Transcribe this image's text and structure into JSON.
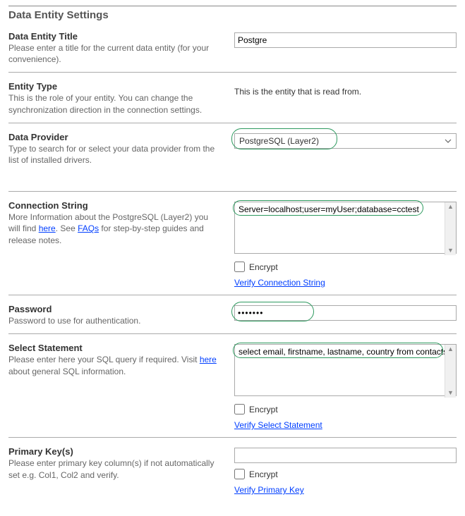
{
  "page_title": "Data Entity Settings",
  "title_section": {
    "label": "Data Entity Title",
    "desc": "Please enter a title for the current data entity (for your convenience).",
    "value": "Postgre"
  },
  "entity_type_section": {
    "label": "Entity Type",
    "desc": "This is the role of your entity. You can change the synchronization direction in the connection settings.",
    "static_text": "This is the entity that is read from."
  },
  "provider_section": {
    "label": "Data Provider",
    "desc": "Type to search for or select your data provider from the list of installed drivers.",
    "value": "PostgreSQL (Layer2)"
  },
  "conn_section": {
    "label": "Connection String",
    "desc_pre": "More Information about the PostgreSQL (Layer2) you will find ",
    "desc_link1": "here",
    "desc_mid": ". See ",
    "desc_link2": "FAQs",
    "desc_post": " for step-by-step guides and release notes.",
    "value": "Server=localhost;user=myUser;database=cctest",
    "encrypt_label": "Encrypt",
    "verify_label": "Verify Connection String"
  },
  "password_section": {
    "label": "Password",
    "desc": "Password to use for authentication.",
    "value": "•••••••"
  },
  "select_section": {
    "label": "Select Statement",
    "desc_pre": "Please enter here your SQL query if required. Visit ",
    "desc_link": "here",
    "desc_post": " about general SQL information.",
    "value": "select email, firstname, lastname, country from contacts",
    "encrypt_label": "Encrypt",
    "verify_label": "Verify Select Statement"
  },
  "pkey_section": {
    "label": "Primary Key(s)",
    "desc": "Please enter primary key column(s) if not automatically set e.g. Col1, Col2 and verify.",
    "value": "",
    "encrypt_label": "Encrypt",
    "verify_label": "Verify Primary Key"
  }
}
